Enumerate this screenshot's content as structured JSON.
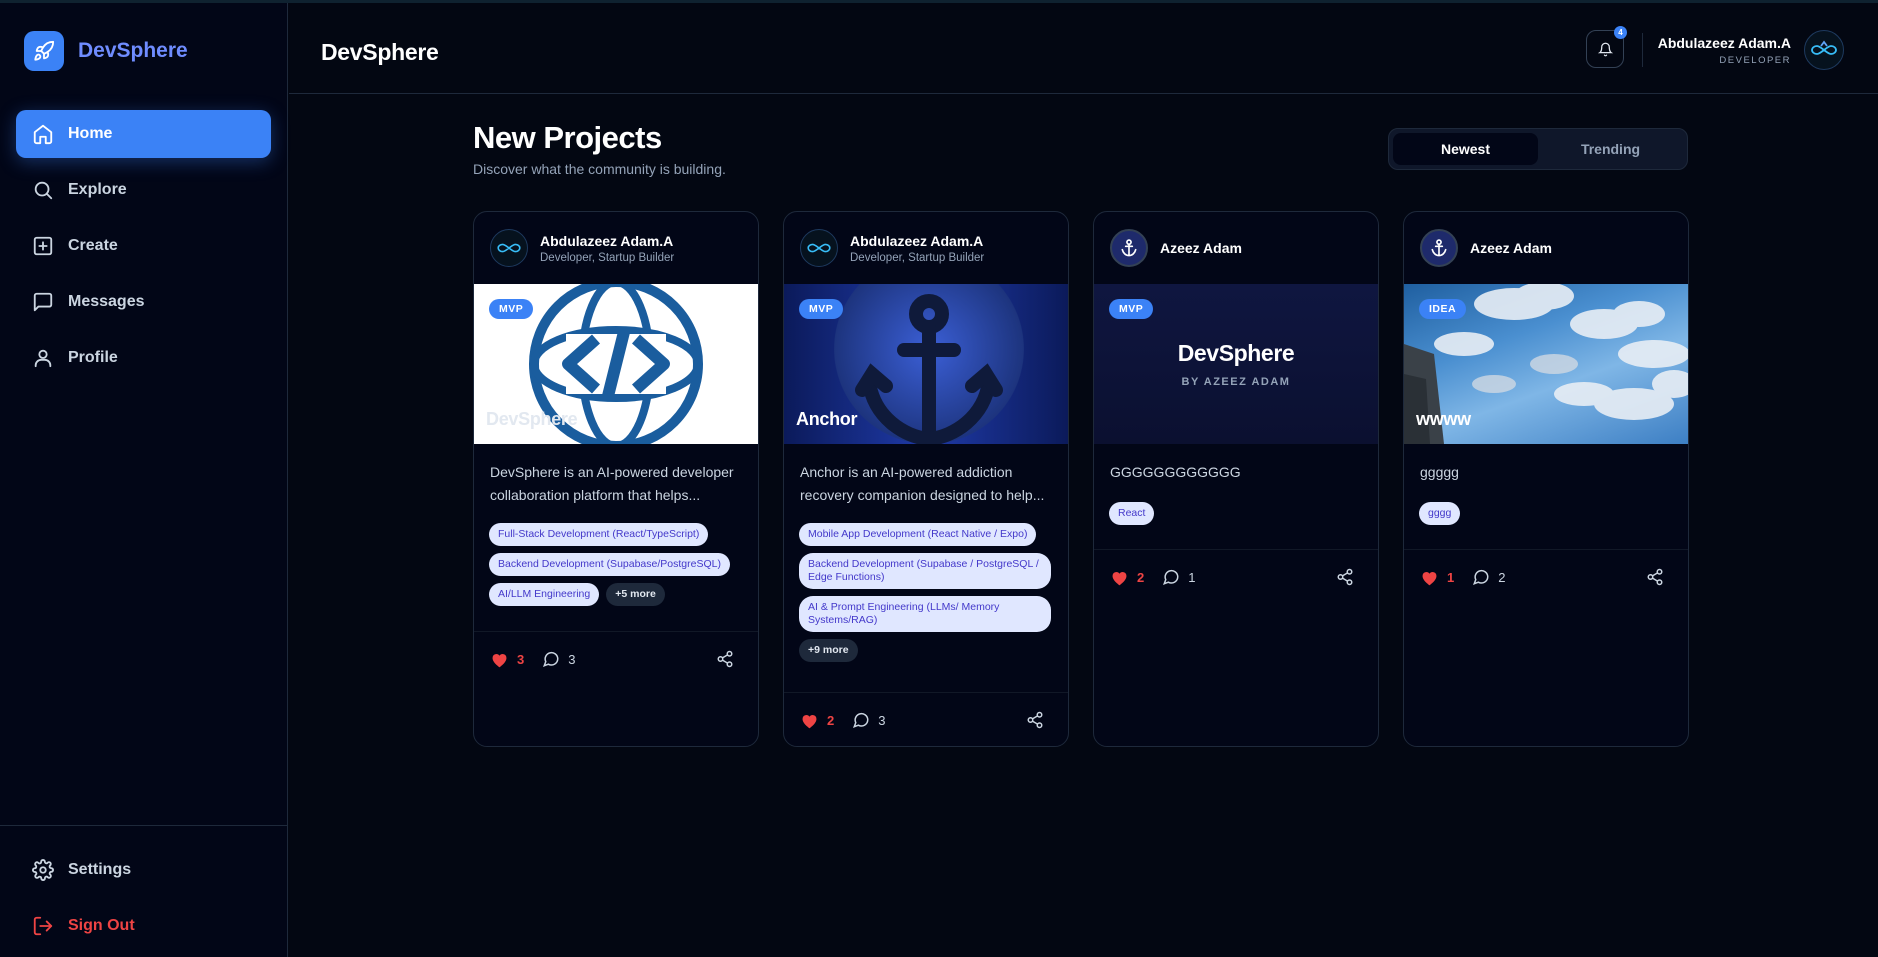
{
  "app": {
    "name": "DevSphere"
  },
  "sidebar": {
    "items": [
      {
        "label": "Home",
        "icon": "home-icon",
        "active": true
      },
      {
        "label": "Explore",
        "icon": "search-icon"
      },
      {
        "label": "Create",
        "icon": "plus-square-icon"
      },
      {
        "label": "Messages",
        "icon": "message-icon"
      },
      {
        "label": "Profile",
        "icon": "user-icon"
      }
    ],
    "settings_label": "Settings",
    "signout_label": "Sign Out"
  },
  "header": {
    "title": "DevSphere",
    "notifications_count": "4",
    "user_name": "Abdulazeez Adam.A",
    "user_role": "DEVELOPER"
  },
  "main": {
    "title": "New Projects",
    "subtitle": "Discover what the community is building.",
    "sort": {
      "newest": "Newest",
      "trending": "Trending",
      "active": "Newest"
    }
  },
  "projects": [
    {
      "author": "Abdulazeez Adam.A",
      "author_role": "Developer, Startup Builder",
      "badge": "MVP",
      "banner_title": "DevSphere",
      "description": "DevSphere is an AI-powered developer collaboration platform that helps...",
      "tags": [
        "Full-Stack Development (React/TypeScript)",
        "Backend Development (Supabase/PostgreSQL)",
        "AI/LLM Engineering"
      ],
      "more": "+5 more",
      "likes": "3",
      "comments": "3"
    },
    {
      "author": "Abdulazeez Adam.A",
      "author_role": "Developer, Startup Builder",
      "badge": "MVP",
      "banner_title": "Anchor",
      "description": "Anchor is an AI-powered addiction recovery companion designed to help...",
      "tags": [
        "Mobile App Development (React Native / Expo)",
        "Backend Development (Supabase / PostgreSQL / Edge Functions)",
        "AI & Prompt Engineering (LLMs/ Memory Systems/RAG)"
      ],
      "more": "+9 more",
      "likes": "2",
      "comments": "3"
    },
    {
      "author": "Azeez Adam",
      "badge": "MVP",
      "banner_title": "DevSphere",
      "banner_subtitle": "BY AZEEZ ADAM",
      "description": "GGGGGGGGGGGG",
      "tags": [
        "React"
      ],
      "likes": "2",
      "comments": "1"
    },
    {
      "author": "Azeez Adam",
      "badge": "IDEA",
      "banner_title": "wwww",
      "description": "ggggg",
      "tags": [
        "gggg"
      ],
      "likes": "1",
      "comments": "2"
    }
  ],
  "colors": {
    "accent": "#3b82f6",
    "like": "#ef4444",
    "background": "#030712"
  }
}
